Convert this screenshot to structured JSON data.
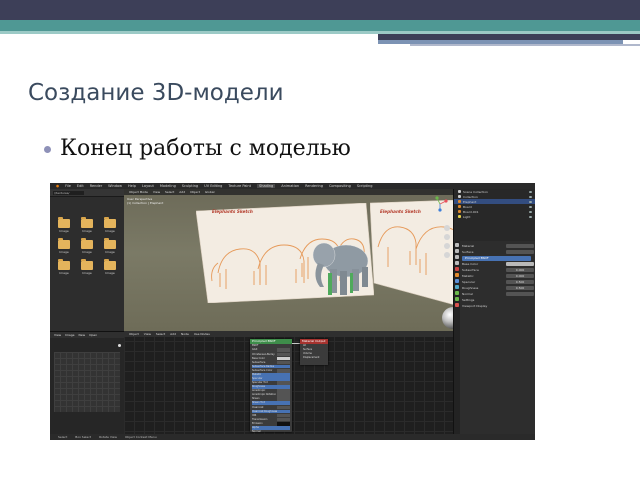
{
  "slide": {
    "title": "Создание 3D-модели",
    "bullet": "Конец работы с моделью"
  },
  "colors": {
    "band_dark": "#3d3f58",
    "band_teal": "#4f9894",
    "title_text": "#3a4a5e",
    "bullet_dot": "#8e91b8",
    "board_title_red": "#b43c2c",
    "outline_orange": "#e69a5a",
    "elephant_model": "#8f9aa3",
    "selection_blue": "#4772b3"
  },
  "blender": {
    "menu": [
      "File",
      "Edit",
      "Render",
      "Window",
      "Help"
    ],
    "workspace_tabs": [
      "Layout",
      "Modeling",
      "Sculpting",
      "UV Editing",
      "Texture Paint",
      "Shading",
      "Animation",
      "Rendering",
      "Compositing",
      "Scripting"
    ],
    "active_workspace": "Shading",
    "file_browser": {
      "path": "//textures/",
      "folders": [
        "Image",
        "Image",
        "Image",
        "Image",
        "Image",
        "Image",
        "Image",
        "Image",
        "Image"
      ]
    },
    "viewport": {
      "header_items": [
        "Object Mode",
        "View",
        "Select",
        "Add",
        "Object",
        "Global"
      ],
      "info_lines": [
        "User Perspective",
        "(1) Collection | Elephant"
      ],
      "board_left_title": "Elephants Sketch",
      "board_right_title": "Elephants Sketch"
    },
    "outliner": {
      "rows": [
        {
          "label": "Scene Collection",
          "selected": false
        },
        {
          "label": "Collection",
          "selected": false
        },
        {
          "label": "Elephant",
          "selected": true
        },
        {
          "label": "Board",
          "selected": false
        },
        {
          "label": "Board.001",
          "selected": false
        },
        {
          "label": "Light",
          "selected": false
        }
      ]
    },
    "properties": {
      "rows": [
        {
          "label": "Material",
          "field": "",
          "highlight": false
        },
        {
          "label": "Surface",
          "field": "",
          "highlight": false
        },
        {
          "label": "Principled BSDF",
          "field": "",
          "highlight": true
        },
        {
          "label": "Base Color",
          "field": "",
          "highlight": false
        },
        {
          "label": "Subsurface",
          "field": "0.000",
          "highlight": false
        },
        {
          "label": "Metallic",
          "field": "0.000",
          "highlight": false
        },
        {
          "label": "Specular",
          "field": "0.500",
          "highlight": false
        },
        {
          "label": "Roughness",
          "field": "0.500",
          "highlight": false
        },
        {
          "label": "Normal",
          "field": "",
          "highlight": false
        },
        {
          "label": "Settings",
          "field": "",
          "highlight": false
        },
        {
          "label": "Viewport Display",
          "field": "",
          "highlight": false
        }
      ]
    },
    "node_editor": {
      "header_items": [
        "Object",
        "View",
        "Select",
        "Add",
        "Node",
        "Use Nodes"
      ],
      "bsdf_title": "Principled BSDF",
      "bsdf_rows": [
        "BSDF",
        "GGX",
        "Christensen-Burley",
        "Base Color",
        "Subsurface",
        "Subsurface Radius",
        "Subsurface Color",
        "Metallic",
        "Specular",
        "Specular Tint",
        "Roughness",
        "Anisotropic",
        "Anisotropic Rotation",
        "Sheen",
        "Sheen Tint",
        "Clearcoat",
        "Clearcoat Roughness",
        "IOR",
        "Transmission",
        "Emission",
        "Alpha",
        "Normal"
      ],
      "output_title": "Material Output",
      "output_rows": [
        "All",
        "Surface",
        "Volume",
        "Displacement"
      ]
    },
    "image_panel": {
      "header_items": [
        "View",
        "Image",
        "New",
        "Open"
      ]
    },
    "status_bar": [
      "Select",
      "Box Select",
      "Rotate View",
      "Object Context Menu"
    ]
  }
}
